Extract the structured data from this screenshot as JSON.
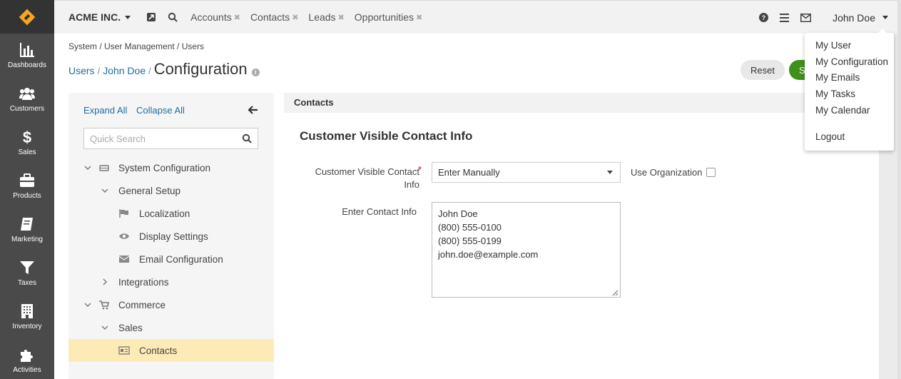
{
  "sidebar": {
    "items": [
      {
        "label": "Dashboards",
        "icon": "bar-chart-icon"
      },
      {
        "label": "Customers",
        "icon": "users-icon"
      },
      {
        "label": "Sales",
        "icon": "dollar-icon"
      },
      {
        "label": "Products",
        "icon": "briefcase-icon"
      },
      {
        "label": "Marketing",
        "icon": "book-icon"
      },
      {
        "label": "Taxes",
        "icon": "filter-icon"
      },
      {
        "label": "Inventory",
        "icon": "building-icon"
      },
      {
        "label": "Activities",
        "icon": "puzzle-icon"
      }
    ]
  },
  "topbar": {
    "org_name": "ACME INC.",
    "pins": [
      "Accounts",
      "Contacts",
      "Leads",
      "Opportunities"
    ],
    "pin_close": "✖",
    "user_name": "John Doe"
  },
  "breadcrumb": "System / User Management / Users",
  "title_row": {
    "link1": "Users",
    "link2": "John Doe",
    "sep": "/",
    "title": "Configuration",
    "info": "i"
  },
  "actions": {
    "reset": "Reset",
    "save": "S"
  },
  "tree": {
    "expand_all": "Expand All",
    "collapse_all": "Collapse All",
    "search_placeholder": "Quick Search",
    "nodes": [
      {
        "label": "System Configuration"
      },
      {
        "label": "General Setup"
      },
      {
        "label": "Localization"
      },
      {
        "label": "Display Settings"
      },
      {
        "label": "Email Configuration"
      },
      {
        "label": "Integrations"
      },
      {
        "label": "Commerce"
      },
      {
        "label": "Sales"
      },
      {
        "label": "Contacts"
      }
    ]
  },
  "content": {
    "header": "Contacts",
    "section_title": "Customer Visible Contact Info",
    "field1_label_line1": "Customer Visible Contact",
    "field1_label_line2": "Info",
    "field1_required": "*",
    "field1_value": "Enter Manually",
    "use_org_label": "Use Organization",
    "field2_label": "Enter Contact Info",
    "contact_lines": [
      "John Doe",
      "(800) 555-0100",
      "(800) 555-0199",
      "john.doe@example.com"
    ]
  },
  "user_menu": {
    "items": [
      "My User",
      "My Configuration",
      "My Emails",
      "My Tasks",
      "My Calendar",
      "Logout"
    ]
  },
  "colors": {
    "sidebar_bg": "#4a4a4a",
    "link": "#1f6d9c",
    "save_green": "#3f8f1a",
    "selected_node": "#fdebb7",
    "logo_orange": "#f5a623"
  }
}
